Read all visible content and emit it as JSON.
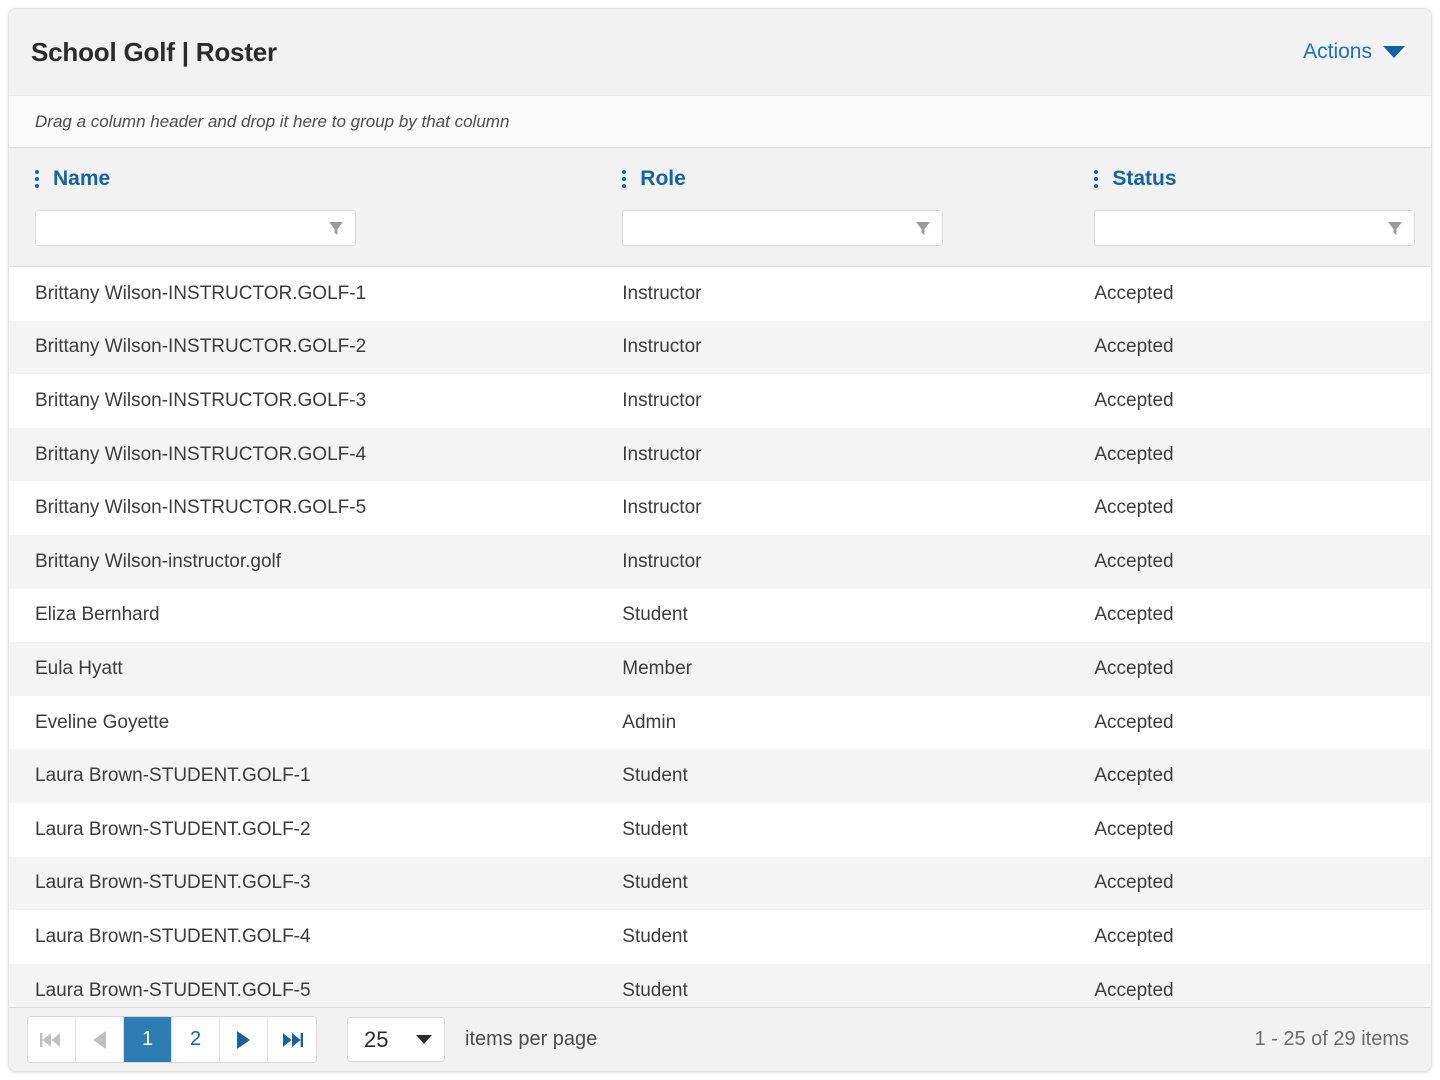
{
  "card": {
    "title": "School Golf | Roster",
    "actions": {
      "label": "Actions",
      "icon": "chevron-down-icon"
    },
    "group_bar_hint": "Drag a column header and drop it here to group by that column"
  },
  "grid": {
    "columns": [
      {
        "key": "name",
        "label": "Name",
        "menu_icon": "kebab-menu-icon",
        "filter_icon": "filter-funnel-icon",
        "filter_value": "",
        "filter_placeholder": ""
      },
      {
        "key": "role",
        "label": "Role",
        "menu_icon": "kebab-menu-icon",
        "filter_icon": "filter-funnel-icon",
        "filter_value": "",
        "filter_placeholder": ""
      },
      {
        "key": "status",
        "label": "Status",
        "menu_icon": "kebab-menu-icon",
        "filter_icon": "filter-funnel-icon",
        "filter_value": "",
        "filter_placeholder": ""
      }
    ],
    "rows": [
      {
        "name": "Brittany Wilson-INSTRUCTOR.GOLF-1",
        "role": "Instructor",
        "status": "Accepted"
      },
      {
        "name": "Brittany Wilson-INSTRUCTOR.GOLF-2",
        "role": "Instructor",
        "status": "Accepted"
      },
      {
        "name": "Brittany Wilson-INSTRUCTOR.GOLF-3",
        "role": "Instructor",
        "status": "Accepted"
      },
      {
        "name": "Brittany Wilson-INSTRUCTOR.GOLF-4",
        "role": "Instructor",
        "status": "Accepted"
      },
      {
        "name": "Brittany Wilson-INSTRUCTOR.GOLF-5",
        "role": "Instructor",
        "status": "Accepted"
      },
      {
        "name": "Brittany Wilson-instructor.golf",
        "role": "Instructor",
        "status": "Accepted"
      },
      {
        "name": "Eliza Bernhard",
        "role": "Student",
        "status": "Accepted"
      },
      {
        "name": "Eula Hyatt",
        "role": "Member",
        "status": "Accepted"
      },
      {
        "name": "Eveline Goyette",
        "role": "Admin",
        "status": "Accepted"
      },
      {
        "name": "Laura Brown-STUDENT.GOLF-1",
        "role": "Student",
        "status": "Accepted"
      },
      {
        "name": "Laura Brown-STUDENT.GOLF-2",
        "role": "Student",
        "status": "Accepted"
      },
      {
        "name": "Laura Brown-STUDENT.GOLF-3",
        "role": "Student",
        "status": "Accepted"
      },
      {
        "name": "Laura Brown-STUDENT.GOLF-4",
        "role": "Student",
        "status": "Accepted"
      },
      {
        "name": "Laura Brown-STUDENT.GOLF-5",
        "role": "Student",
        "status": "Accepted"
      }
    ]
  },
  "pager": {
    "first_icon": "go-to-first-page-icon",
    "prev_icon": "previous-page-icon",
    "next_icon": "next-page-icon",
    "last_icon": "go-to-last-page-icon",
    "pages": [
      {
        "label": "1",
        "active": true
      },
      {
        "label": "2",
        "active": false
      }
    ],
    "page_size": "25",
    "page_size_caret": "chevron-down-icon",
    "per_page_label": "items per page",
    "items_info": "1 - 25 of 29 items"
  },
  "colors": {
    "accent": "#1464a5",
    "active_page_bg": "#2e7db2",
    "link": "#1e70bf",
    "title_bar_bg": "#f2f2f2",
    "group_bar_bg": "#fafafa",
    "row_alt_bg": "#f4f4f4"
  }
}
